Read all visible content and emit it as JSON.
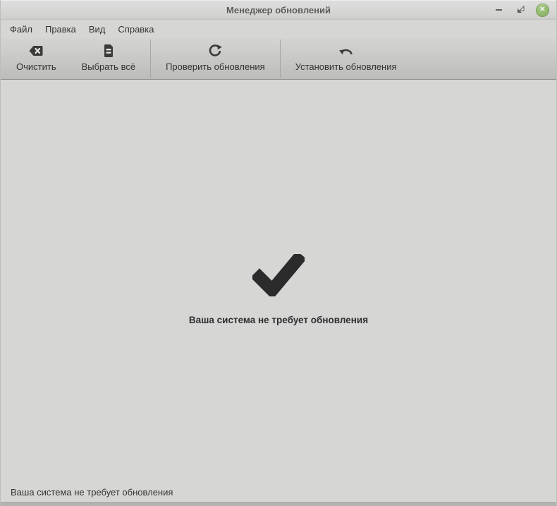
{
  "window": {
    "title": "Менеджер обновлений",
    "controls": {
      "minimize": "minimize-icon",
      "maximize": "maximize-icon",
      "close": "close-icon",
      "close_glyph": "✕"
    }
  },
  "menubar": {
    "items": [
      {
        "label": "Файл"
      },
      {
        "label": "Правка"
      },
      {
        "label": "Вид"
      },
      {
        "label": "Справка"
      }
    ]
  },
  "toolbar": {
    "buttons": [
      {
        "label": "Очистить",
        "icon": "clear-icon"
      },
      {
        "label": "Выбрать всё",
        "icon": "select-all-icon"
      },
      {
        "label": "Проверить обновления",
        "icon": "refresh-icon"
      },
      {
        "label": "Установить обновления",
        "icon": "install-icon"
      }
    ]
  },
  "main": {
    "icon": "checkmark-icon",
    "message": "Ваша система не требует обновления"
  },
  "statusbar": {
    "text": "Ваша система не требует обновления"
  },
  "colors": {
    "close_button_green": "#8db468",
    "checkmark_dark": "#2b2b2b",
    "window_background": "#d6d6d4",
    "toolbar_bottom": "#bcbcba",
    "toolbar_border": "#8f8f8d"
  }
}
